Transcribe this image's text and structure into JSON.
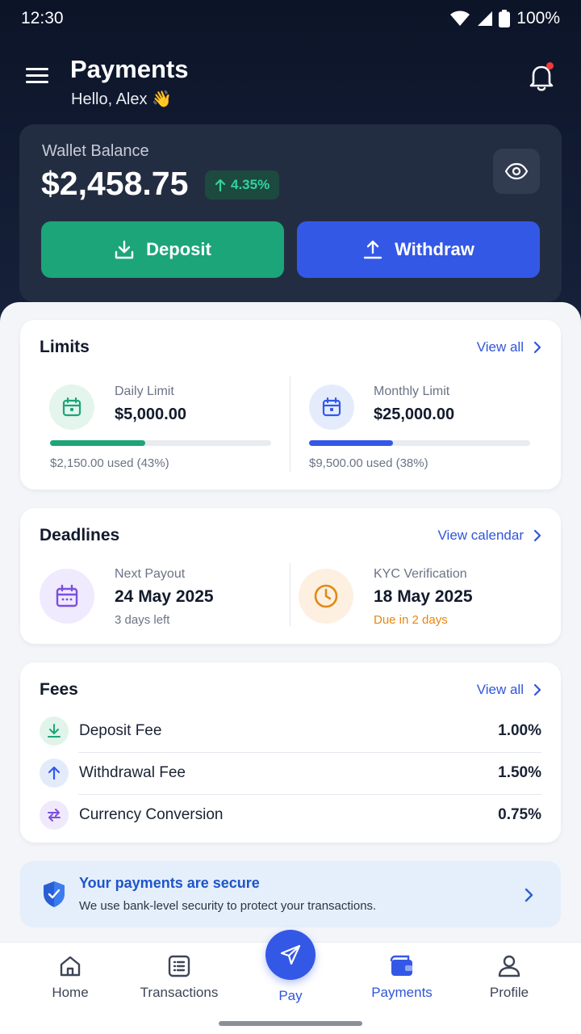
{
  "status_bar": {
    "time": "12:30",
    "battery": "100%"
  },
  "header": {
    "title": "Payments",
    "greeting": "Hello, Alex 👋"
  },
  "wallet": {
    "label": "Wallet Balance",
    "amount": "$2,458.75",
    "change": "4.35%",
    "deposit_label": "Deposit",
    "withdraw_label": "Withdraw"
  },
  "limits": {
    "title": "Limits",
    "link": "View all",
    "items": [
      {
        "label": "Daily Limit",
        "value": "$5,000.00",
        "used": "$2,150.00 used (43%)",
        "progress": 0.43,
        "color": "#1ca578"
      },
      {
        "label": "Monthly Limit",
        "value": "$25,000.00",
        "used": "$9,500.00 used (38%)",
        "progress": 0.38,
        "color": "#3458e6"
      }
    ]
  },
  "deadlines": {
    "title": "Deadlines",
    "link": "View calendar",
    "items": [
      {
        "label": "Next Payout",
        "value": "24 May 2025",
        "sub": "3 days left"
      },
      {
        "label": "KYC Verification",
        "value": "18 May 2025",
        "sub": "Due in 2 days"
      }
    ]
  },
  "fees": {
    "title": "Fees",
    "link": "View all",
    "items": [
      {
        "name": "Deposit Fee",
        "value": "1.00%"
      },
      {
        "name": "Withdrawal Fee",
        "value": "1.50%"
      },
      {
        "name": "Currency Conversion",
        "value": "0.75%"
      }
    ]
  },
  "security": {
    "title": "Your payments are secure",
    "description": "We use bank-level security to protect your transactions."
  },
  "nav": {
    "items": [
      {
        "label": "Home"
      },
      {
        "label": "Transactions"
      },
      {
        "label": "Pay"
      },
      {
        "label": "Payments"
      },
      {
        "label": "Profile"
      }
    ],
    "active": "Payments"
  },
  "colors": {
    "accent": "#3458e6",
    "success": "#1ca578",
    "warning": "#e8860f",
    "hero_bg": "#0c1428"
  }
}
